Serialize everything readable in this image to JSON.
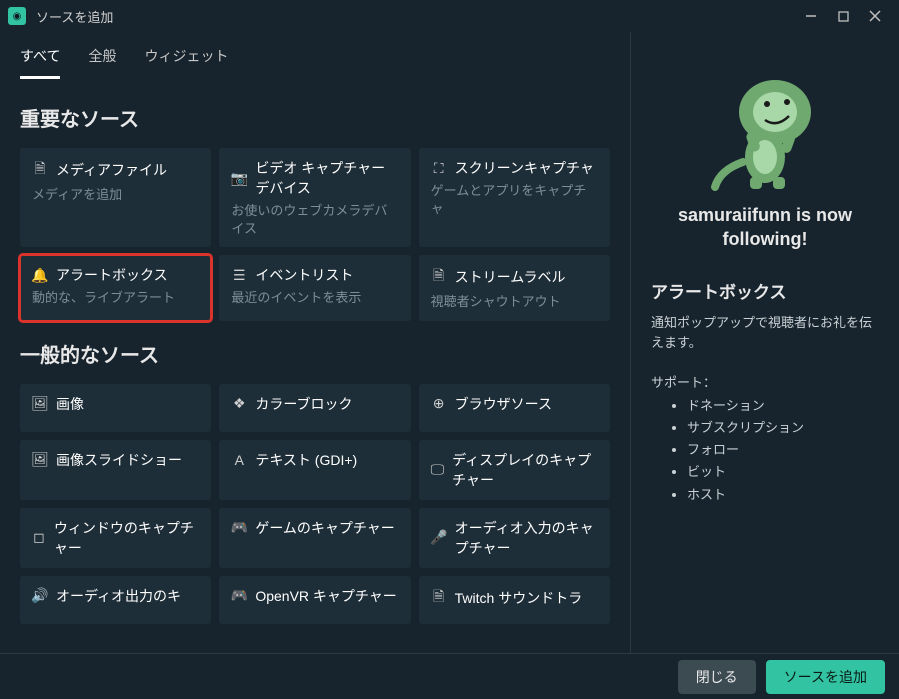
{
  "window": {
    "title": "ソースを追加"
  },
  "tabs": [
    {
      "label": "すべて",
      "active": true
    },
    {
      "label": "全般",
      "active": false
    },
    {
      "label": "ウィジェット",
      "active": false
    }
  ],
  "sections": {
    "important": {
      "title": "重要なソース",
      "items": [
        {
          "icon": "file-icon",
          "glyph": "🗎",
          "title": "メディアファイル",
          "desc": "メディアを追加"
        },
        {
          "icon": "video-icon",
          "glyph": "📷",
          "title": "ビデオ キャプチャー デバイス",
          "desc": "お使いのウェブカメラデバイス"
        },
        {
          "icon": "screen-icon",
          "glyph": "⛶",
          "title": "スクリーンキャプチャ",
          "desc": "ゲームとアプリをキャプチャ"
        },
        {
          "icon": "bell-icon",
          "glyph": "🔔",
          "title": "アラートボックス",
          "desc": "動的な、ライブアラート",
          "selected": true
        },
        {
          "icon": "list-icon",
          "glyph": "☰",
          "title": "イベントリスト",
          "desc": "最近のイベントを表示"
        },
        {
          "icon": "label-icon",
          "glyph": "🗎",
          "title": "ストリームラベル",
          "desc": "視聴者シャウトアウト"
        }
      ]
    },
    "general": {
      "title": "一般的なソース",
      "items": [
        {
          "icon": "image-icon",
          "glyph": "🖼",
          "title": "画像",
          "desc": ""
        },
        {
          "icon": "palette-icon",
          "glyph": "❖",
          "title": "カラーブロック",
          "desc": ""
        },
        {
          "icon": "globe-icon",
          "glyph": "⊕",
          "title": "ブラウザソース",
          "desc": ""
        },
        {
          "icon": "slideshow-icon",
          "glyph": "🖼",
          "title": "画像スライドショー",
          "desc": ""
        },
        {
          "icon": "text-icon",
          "glyph": "A",
          "title": "テキスト (GDI+)",
          "desc": ""
        },
        {
          "icon": "display-icon",
          "glyph": "🖵",
          "title": "ディスプレイのキャプチャー",
          "desc": ""
        },
        {
          "icon": "window-icon",
          "glyph": "◻",
          "title": "ウィンドウのキャプチャー",
          "desc": ""
        },
        {
          "icon": "gamepad-icon",
          "glyph": "🎮",
          "title": "ゲームのキャプチャー",
          "desc": ""
        },
        {
          "icon": "mic-icon",
          "glyph": "🎤",
          "title": "オーディオ入力のキャプチャー",
          "desc": ""
        },
        {
          "icon": "speaker-icon",
          "glyph": "🔊",
          "title": "オーディオ出力のキ",
          "desc": ""
        },
        {
          "icon": "vr-icon",
          "glyph": "🎮",
          "title": "OpenVR キャプチャー",
          "desc": ""
        },
        {
          "icon": "music-icon",
          "glyph": "🗎",
          "title": "Twitch サウンドトラ",
          "desc": ""
        }
      ]
    }
  },
  "detail": {
    "preview_caption": "samuraiifunn is now following!",
    "title": "アラートボックス",
    "desc": "通知ポップアップで視聴者にお礼を伝えます。",
    "support_label": "サポート：",
    "support_items": [
      "ドネーション",
      "サブスクリプション",
      "フォロー",
      "ビット",
      "ホスト"
    ]
  },
  "footer": {
    "close": "閉じる",
    "add": "ソースを追加"
  }
}
